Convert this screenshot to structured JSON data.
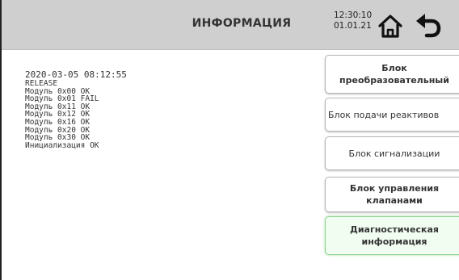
{
  "header": {
    "title": "ИНФОРМАЦИЯ",
    "time": "12:30:10",
    "date": "01.01.21",
    "home_icon": "home-icon",
    "back_icon": "back-arrow-icon"
  },
  "log": {
    "lines": [
      "2020-03-05 08:12:55",
      "RELEASE",
      "Модуль 0x00 OK",
      "Модуль 0x01 FAIL",
      "Модуль 0x11 OK",
      "Модуль 0x12 OK",
      "Модуль 0x16 OK",
      "Модуль 0x20 OK",
      "Модуль 0x30 OK",
      "Инициализация OK"
    ]
  },
  "menu": {
    "items": [
      {
        "line1": "Блок",
        "line2": "преобразовательный"
      },
      {
        "line1": "Блок подачи реактивов",
        "line2": ""
      },
      {
        "line1": "Блок сигнализации",
        "line2": ""
      },
      {
        "line1": "Блок управления",
        "line2": "клапанами"
      },
      {
        "line1": "Диагностическая",
        "line2": "информация"
      }
    ],
    "active_index": 4
  },
  "colors": {
    "header_bg": "#cfcfcf",
    "active_border": "#8fd48f",
    "text": "#333333"
  }
}
